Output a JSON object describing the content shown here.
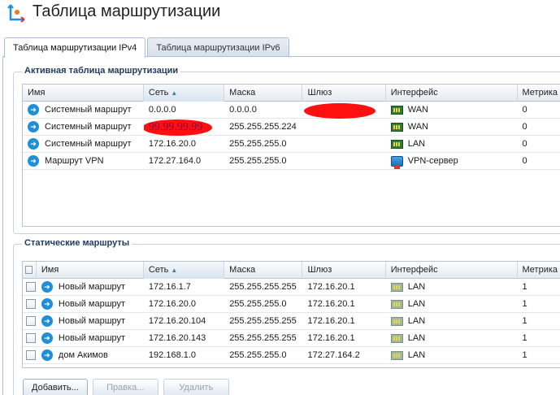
{
  "page": {
    "title": "Таблица маршрутизации"
  },
  "tabs": [
    {
      "label": "Таблица маршрутизации IPv4",
      "active": true
    },
    {
      "label": "Таблица маршрутизации IPv6",
      "active": false
    }
  ],
  "active_table": {
    "group_title": "Активная таблица маршрутизации",
    "columns": [
      "Имя",
      "Сеть",
      "Маска",
      "Шлюз",
      "Интерфейс",
      "Метрика"
    ],
    "sorted_column": "Сеть",
    "rows": [
      {
        "name": "Системный маршрут",
        "network": "0.0.0.0",
        "mask": "0.0.0.0",
        "gateway": "",
        "interface": "WAN",
        "metric": "0"
      },
      {
        "name": "Системный маршрут",
        "network": "99.99.99.99",
        "mask": "255.255.255.224",
        "gateway": "",
        "interface": "WAN",
        "metric": "0"
      },
      {
        "name": "Системный маршрут",
        "network": "172.16.20.0",
        "mask": "255.255.255.0",
        "gateway": "",
        "interface": "LAN",
        "metric": "0"
      },
      {
        "name": "Маршрут VPN",
        "network": "172.27.164.0",
        "mask": "255.255.255.0",
        "gateway": "",
        "interface": "VPN-сервер",
        "metric": "0"
      }
    ]
  },
  "static_routes": {
    "group_title": "Статические маршруты",
    "columns": [
      "Имя",
      "Сеть",
      "Маска",
      "Шлюз",
      "Интерфейс",
      "Метрика"
    ],
    "sorted_column": "Сеть",
    "rows": [
      {
        "name": "Новый маршрут",
        "network": "172.16.1.7",
        "mask": "255.255.255.255",
        "gateway": "172.16.20.1",
        "interface": "LAN",
        "metric": "1"
      },
      {
        "name": "Новый маршрут",
        "network": "172.16.20.0",
        "mask": "255.255.255.0",
        "gateway": "172.16.20.1",
        "interface": "LAN",
        "metric": "1"
      },
      {
        "name": "Новый маршрут",
        "network": "172.16.20.104",
        "mask": "255.255.255.255",
        "gateway": "172.16.20.1",
        "interface": "LAN",
        "metric": "1"
      },
      {
        "name": "Новый маршрут",
        "network": "172.16.20.143",
        "mask": "255.255.255.255",
        "gateway": "172.16.20.1",
        "interface": "LAN",
        "metric": "1"
      },
      {
        "name": "дом Акимов",
        "network": "192.168.1.0",
        "mask": "255.255.255.0",
        "gateway": "172.27.164.2",
        "interface": "LAN",
        "metric": "1"
      }
    ]
  },
  "buttons": {
    "add": "Добавить...",
    "edit": "Правка...",
    "delete": "Удалить"
  },
  "colors": {
    "accent": "#1f8fd8",
    "redaction": "#ff1010",
    "border": "#a9bfd6"
  }
}
